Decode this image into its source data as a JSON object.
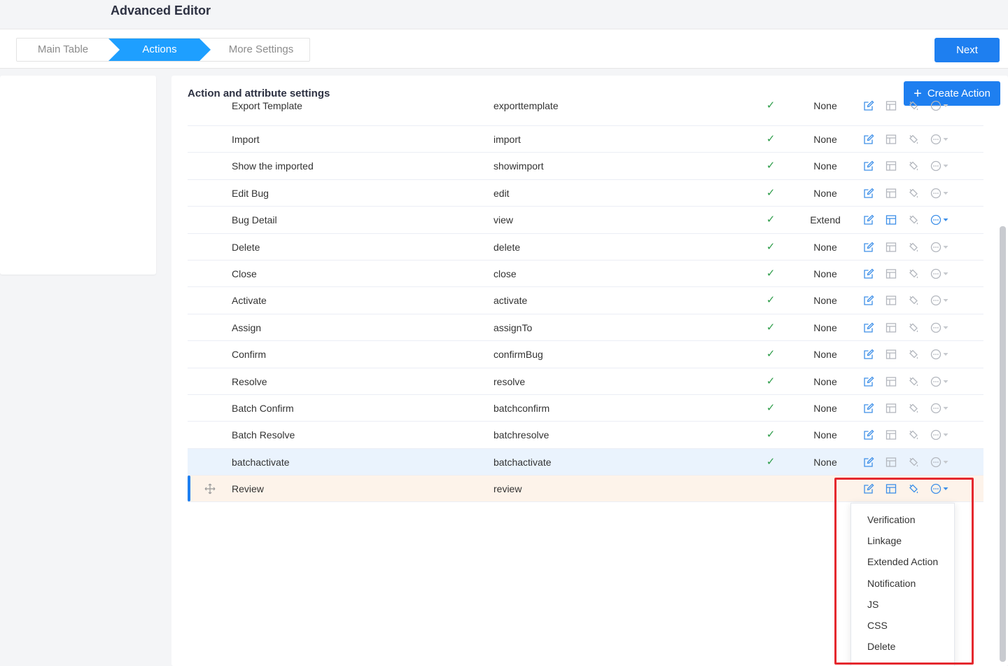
{
  "page": {
    "title": "Advanced Editor"
  },
  "steps": [
    "Main Table",
    "Actions",
    "More Settings"
  ],
  "header": {
    "next_label": "Next"
  },
  "section": {
    "title": "Action and attribute settings",
    "create_label": "Create Action"
  },
  "rows": [
    {
      "name": "Export Template",
      "code": "exporttemplate",
      "checked": "✓",
      "extend": "None"
    },
    {
      "name": "Import",
      "code": "import",
      "checked": "✓",
      "extend": "None"
    },
    {
      "name": "Show the imported",
      "code": "showimport",
      "checked": "✓",
      "extend": "None"
    },
    {
      "name": "Edit Bug",
      "code": "edit",
      "checked": "✓",
      "extend": "None"
    },
    {
      "name": "Bug Detail",
      "code": "view",
      "checked": "✓",
      "extend": "Extend"
    },
    {
      "name": "Delete",
      "code": "delete",
      "checked": "✓",
      "extend": "None"
    },
    {
      "name": "Close",
      "code": "close",
      "checked": "✓",
      "extend": "None"
    },
    {
      "name": "Activate",
      "code": "activate",
      "checked": "✓",
      "extend": "None"
    },
    {
      "name": "Assign",
      "code": "assignTo",
      "checked": "✓",
      "extend": "None"
    },
    {
      "name": "Confirm",
      "code": "confirmBug",
      "checked": "✓",
      "extend": "None"
    },
    {
      "name": "Resolve",
      "code": "resolve",
      "checked": "✓",
      "extend": "None"
    },
    {
      "name": "Batch Confirm",
      "code": "batchconfirm",
      "checked": "✓",
      "extend": "None"
    },
    {
      "name": "Batch Resolve",
      "code": "batchresolve",
      "checked": "✓",
      "extend": "None"
    },
    {
      "name": "batchactivate",
      "code": "batchactivate",
      "checked": "✓",
      "extend": "None"
    },
    {
      "name": "Review",
      "code": "review",
      "checked": "",
      "extend": ""
    }
  ],
  "dropdown": [
    "Verification",
    "Linkage",
    "Extended Action",
    "Notification",
    "JS",
    "CSS",
    "Delete"
  ],
  "icons": [
    "edit-icon",
    "layout-icon",
    "paint-bucket-icon",
    "more-icon",
    "chevron-down-icon",
    "drag-move-icon"
  ],
  "colors": {
    "primary": "#1e7ff0",
    "step_active": "#1e9fff",
    "check": "#2e9d4a",
    "highlight_box": "#e5292f",
    "row_hover": "#eaf3fd",
    "row_active": "#fdf3ea"
  }
}
